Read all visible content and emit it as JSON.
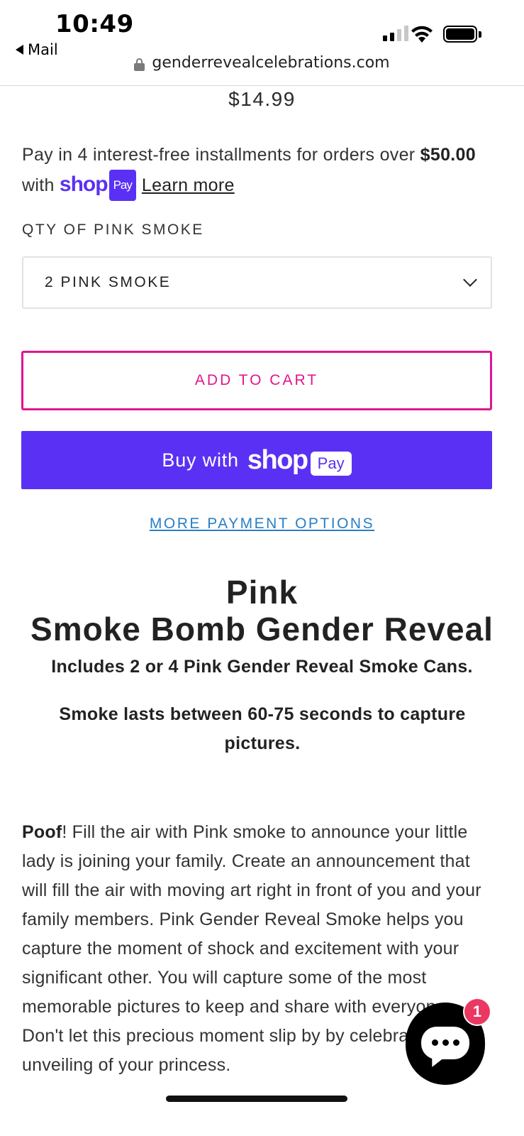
{
  "status_bar": {
    "time": "10:49",
    "back_app": "Mail",
    "url": "genderrevealcelebrations.com"
  },
  "product": {
    "price": "$14.99",
    "installments": {
      "text_before": "Pay in 4 interest-free installments for orders over ",
      "threshold": "$50.00",
      "text_with": " with ",
      "shop_word": "shop",
      "pay_badge": "Pay",
      "learn_more": "Learn more"
    },
    "qty_label": "QTY OF PINK SMOKE",
    "qty_selected": "2 PINK SMOKE",
    "add_to_cart": "ADD TO CART",
    "buy_with": "Buy with",
    "buy_shop_word": "shop",
    "buy_pay_badge": "Pay",
    "more_payment_options": "MORE PAYMENT OPTIONS"
  },
  "content": {
    "title_line1": "Pink",
    "title_line2": "Smoke Bomb Gender Reveal",
    "subtitle1": "Includes 2 or 4 Pink Gender Reveal Smoke Cans.",
    "subtitle2": "Smoke lasts between 60-75 seconds to capture pictures.",
    "description_bold": "Poof",
    "description_rest": "! Fill the air with Pink smoke to announce your little lady is joining your family. Create an announcement that will fill the air with moving art right in front of you and your family members. Pink Gender Reveal Smoke helps you capture the moment of shock and excitement with your significant other. You will capture some of the most memorable pictures to keep and share with everyone. Don't let this precious moment slip by by celebrating the unveiling of your princess."
  },
  "chat": {
    "badge_count": "1"
  },
  "colors": {
    "accent_pink": "#e0168f",
    "shop_pay_purple": "#5a31f4",
    "link_blue": "#2a7ec4",
    "badge_red": "#ea3862"
  }
}
